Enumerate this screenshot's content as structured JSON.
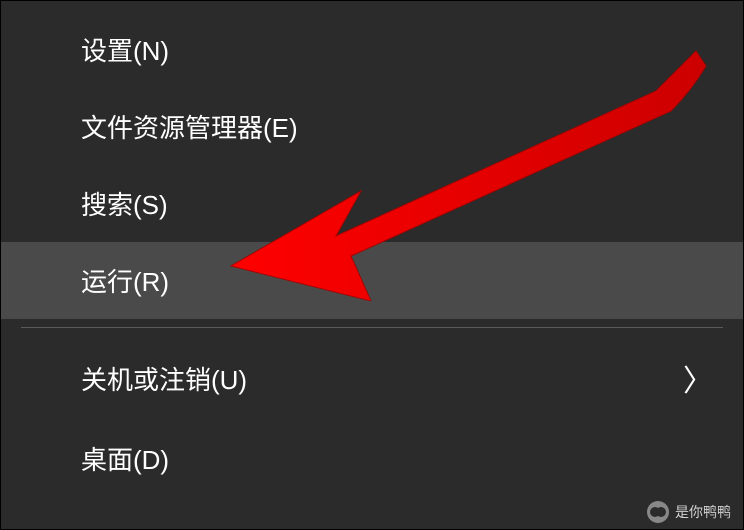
{
  "menu": {
    "items": [
      {
        "label": "设置(N)",
        "highlighted": false,
        "has_submenu": false
      },
      {
        "label": "文件资源管理器(E)",
        "highlighted": false,
        "has_submenu": false
      },
      {
        "label": "搜索(S)",
        "highlighted": false,
        "has_submenu": false
      },
      {
        "label": "运行(R)",
        "highlighted": true,
        "has_submenu": false
      },
      {
        "separator": true
      },
      {
        "label": "关机或注销(U)",
        "highlighted": false,
        "has_submenu": true
      },
      {
        "label": "桌面(D)",
        "highlighted": false,
        "has_submenu": false
      }
    ]
  },
  "annotation": {
    "arrow_color": "#ff0000"
  },
  "watermark": {
    "text": "是你鸭鸭"
  }
}
